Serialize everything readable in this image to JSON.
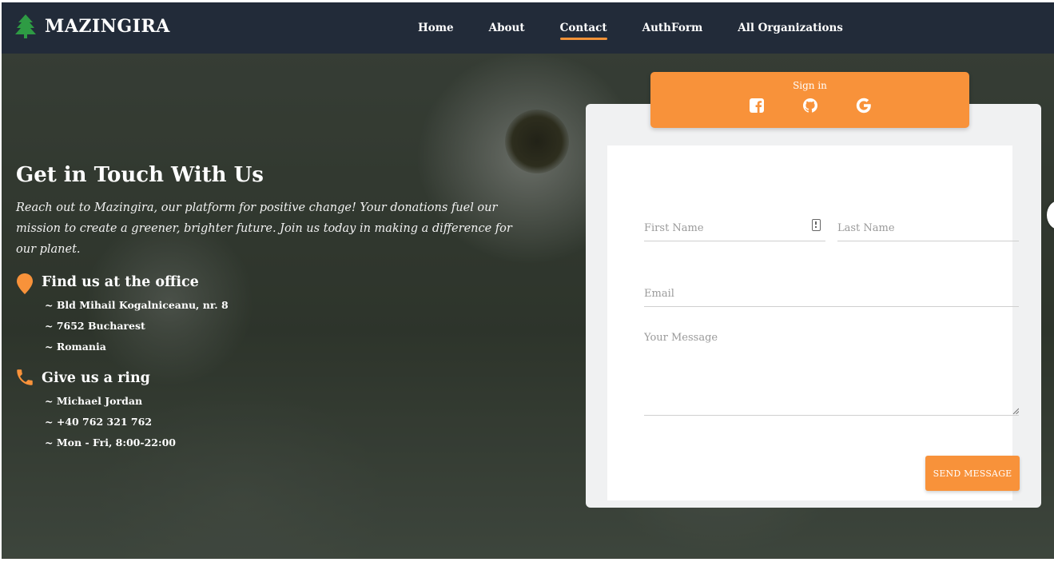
{
  "brand": {
    "name": "MAZINGIRA",
    "icon": "pine-tree-icon",
    "icon_color": "#2e9b44"
  },
  "nav": {
    "items": [
      {
        "label": "Home",
        "active": false
      },
      {
        "label": "About",
        "active": false
      },
      {
        "label": "Contact",
        "active": true
      },
      {
        "label": "AuthForm",
        "active": false
      },
      {
        "label": "All Organizations",
        "active": false
      }
    ]
  },
  "info": {
    "title": "Get in Touch With Us",
    "description": "Reach out to Mazingira, our platform for positive change! Your donations fuel our mission to create a greener, brighter future. Join us today in making a difference for our planet.",
    "office": {
      "icon": "map-pin-icon",
      "title": "Find us at the office",
      "lines": [
        "~ Bld Mihail Kogalniceanu, nr. 8",
        "~ 7652 Bucharest",
        "~ Romania"
      ]
    },
    "phone": {
      "icon": "phone-icon",
      "title": "Give us a ring",
      "lines": [
        "~ Michael Jordan",
        "~ +40 762 321 762",
        "~ Mon - Fri, 8:00-22:00"
      ]
    }
  },
  "signin": {
    "label": "Sign in",
    "providers": [
      "facebook-icon",
      "github-icon",
      "google-icon"
    ]
  },
  "form": {
    "first_name_placeholder": "First Name",
    "last_name_placeholder": "Last Name",
    "email_placeholder": "Email",
    "message_placeholder": "Your Message",
    "submit_label": "SEND MESSAGE"
  },
  "colors": {
    "accent": "#f8923a",
    "navbar": "#222b39",
    "card": "#f0f1f2"
  }
}
